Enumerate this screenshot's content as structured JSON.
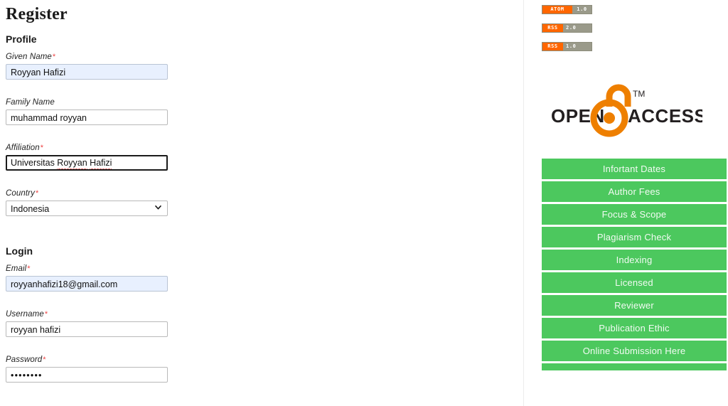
{
  "page": {
    "title": "Register"
  },
  "profile": {
    "heading": "Profile",
    "fields": [
      {
        "label": "Given Name",
        "required": true,
        "value": "Royyan Hafizi",
        "state": "autofill"
      },
      {
        "label": "Family Name",
        "required": false,
        "value": "muhammad royyan",
        "state": "normal"
      },
      {
        "label": "Affiliation",
        "required": true,
        "value": "Universitas Royyan Hafizi",
        "value_ok": "Universitas ",
        "value_misspelled_1": "Royyan",
        "value_space": " ",
        "value_misspelled_2": "Hafizi",
        "state": "focused"
      },
      {
        "label": "Country",
        "required": true,
        "value": "Indonesia",
        "state": "select",
        "options": [
          "Indonesia"
        ]
      }
    ]
  },
  "login": {
    "heading": "Login",
    "fields": [
      {
        "label": "Email",
        "required": true,
        "value": "royyanhafizi18@gmail.com",
        "state": "autofill"
      },
      {
        "label": "Username",
        "required": true,
        "value": "royyan hafizi",
        "state": "normal"
      },
      {
        "label": "Password",
        "required": true,
        "value": "••••••••",
        "state": "password"
      }
    ]
  },
  "required_marker": "*",
  "sidebar": {
    "feeds": [
      {
        "name": "ATOM",
        "version": "1.0",
        "kind": "atom"
      },
      {
        "name": "RSS",
        "version": "2.0",
        "kind": "rss"
      },
      {
        "name": "RSS",
        "version": "1.0",
        "kind": "rss"
      }
    ],
    "open_access": {
      "word_left": "OPEN",
      "word_right": "ACCESS",
      "trademark": "TM"
    },
    "nav_buttons": [
      {
        "label": "Infortant Dates"
      },
      {
        "label": "Author Fees"
      },
      {
        "label": "Focus & Scope"
      },
      {
        "label": "Plagiarism Check"
      },
      {
        "label": "Indexing"
      },
      {
        "label": "Licensed"
      },
      {
        "label": "Reviewer"
      },
      {
        "label": "Publication Ethic"
      },
      {
        "label": "Online Submission Here"
      },
      {
        "label": ""
      }
    ]
  },
  "colors": {
    "green": "#4cc85e",
    "orange": "#ff6600",
    "badge_gray": "#9a9a8a",
    "autofill_blue": "#e8f0fe",
    "required_red": "#ee4444",
    "oa_orange": "#ee7f00"
  }
}
